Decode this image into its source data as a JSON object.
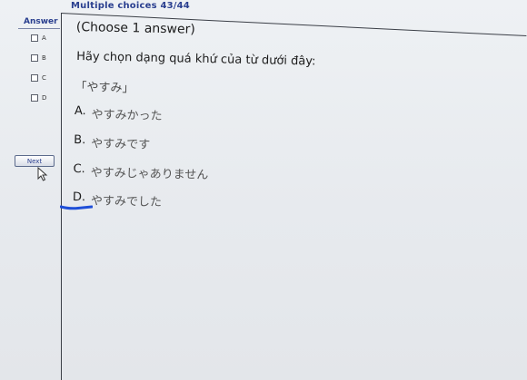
{
  "header": {
    "title": "Multiple choices 43/44"
  },
  "sidebar": {
    "title": "Answer",
    "options": [
      "A",
      "B",
      "C",
      "D"
    ],
    "next_label": "Next"
  },
  "question": {
    "instruction": "(Choose 1 answer)",
    "prompt": "Hãy chọn dạng quá khứ của từ dưới đây:",
    "word": "「やすみ」",
    "answers": [
      {
        "letter": "A.",
        "text": "やすみかった"
      },
      {
        "letter": "B.",
        "text": "やすみです"
      },
      {
        "letter": "C.",
        "text": "やすみじゃありません"
      },
      {
        "letter": "D.",
        "text": "やすみでした"
      }
    ]
  },
  "colors": {
    "accent": "#2a3f8f",
    "underline_mark": "#1f4fd8"
  }
}
